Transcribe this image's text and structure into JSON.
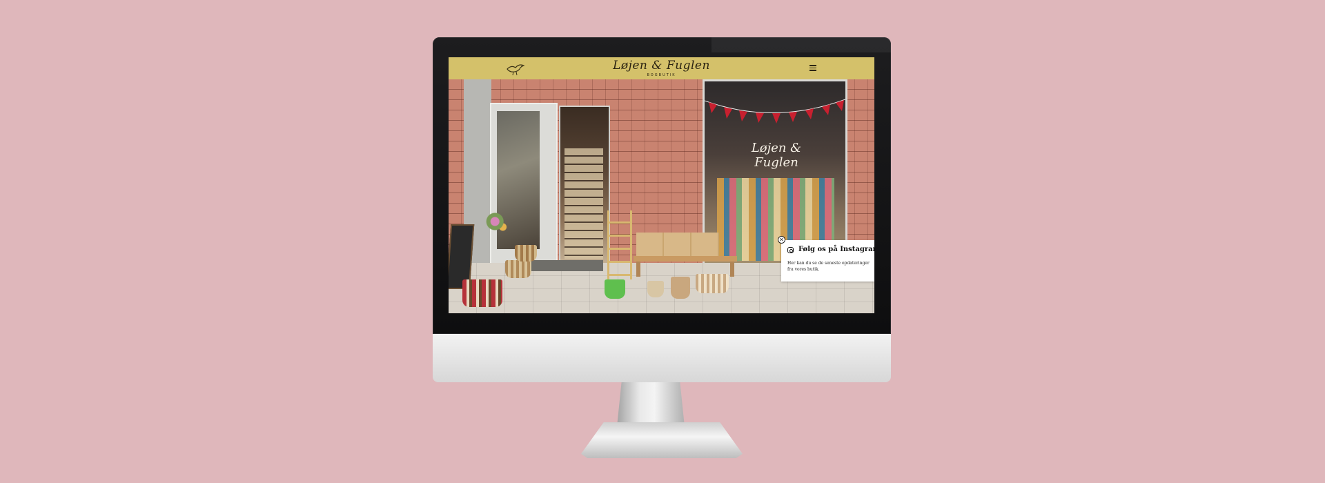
{
  "site": {
    "logo_text": "Løjen & Fuglen",
    "logo_subtitle": "BOGBUTIK"
  },
  "window_sign": {
    "text": "Løjen & Fuglen"
  },
  "instagram_popup": {
    "close_symbol": "✕",
    "title": "Følg os på Instagram!",
    "text": "Her kan du se de seneste opdateringer fra vores butik."
  },
  "icons": {
    "header_left": "bird-icon",
    "header_right": "hamburger-menu-icon",
    "popup": "instagram-icon",
    "popup_close": "close-icon"
  },
  "colors": {
    "background": "#dfb7bb",
    "header": "#d4c16a",
    "bezel": "#141415",
    "popup": "#ffffff"
  }
}
